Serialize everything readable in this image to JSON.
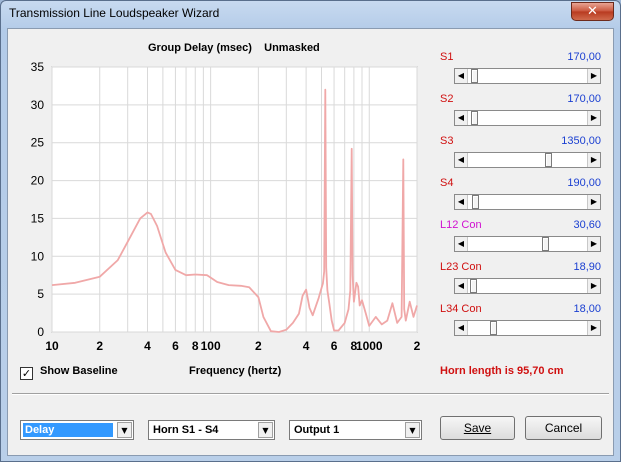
{
  "window": {
    "title": "Transmission Line Loudspeaker Wizard",
    "close_glyph": "✕"
  },
  "chart_header": "Group Delay (msec)    Unmasked",
  "chart_data": {
    "type": "line",
    "title": "Group Delay (msec)",
    "subtitle": "Unmasked",
    "xlabel": "Frequency (hertz)",
    "ylabel": "",
    "x_scale": "log",
    "xlim": [
      10,
      2000
    ],
    "ylim": [
      0,
      35
    ],
    "y_ticks": [
      0,
      5,
      10,
      15,
      20,
      25,
      30,
      35
    ],
    "x_ticks": [
      {
        "value": 10,
        "label": "10"
      },
      {
        "value": 20,
        "label": "2"
      },
      {
        "value": 40,
        "label": "4"
      },
      {
        "value": 60,
        "label": "6"
      },
      {
        "value": 80,
        "label": "8"
      },
      {
        "value": 100,
        "label": "100"
      },
      {
        "value": 200,
        "label": "2"
      },
      {
        "value": 400,
        "label": "4"
      },
      {
        "value": 600,
        "label": "6"
      },
      {
        "value": 800,
        "label": "8"
      },
      {
        "value": 1000,
        "label": "1000"
      },
      {
        "value": 2000,
        "label": "2"
      }
    ],
    "grid": true,
    "line_color": "#f0a8a8",
    "series": [
      {
        "x": [
          10,
          14,
          20,
          26,
          32,
          36,
          40,
          42,
          46,
          52,
          60,
          70,
          80,
          95,
          110,
          130,
          155,
          175,
          200,
          215,
          240,
          270,
          300,
          330,
          360,
          380,
          400,
          420,
          440,
          460,
          480,
          500,
          510,
          520,
          528,
          535,
          545,
          560,
          580,
          600,
          640,
          700,
          740,
          760,
          775,
          785,
          800,
          830,
          850,
          870,
          900,
          950,
          1000,
          1100,
          1200,
          1300,
          1400,
          1500,
          1600,
          1640,
          1660,
          1700,
          1800,
          1900,
          2000
        ],
        "y": [
          6.2,
          6.5,
          7.3,
          9.5,
          13.0,
          15.0,
          15.8,
          15.6,
          14.0,
          10.5,
          8.2,
          7.5,
          7.6,
          7.5,
          6.6,
          6.2,
          6.1,
          5.9,
          4.6,
          2.0,
          0.1,
          0.0,
          0.3,
          1.2,
          2.4,
          4.8,
          5.6,
          3.2,
          2.2,
          3.4,
          4.5,
          5.8,
          6.4,
          8.0,
          32.0,
          8.5,
          5.5,
          3.8,
          1.5,
          0.2,
          0.2,
          1.2,
          3.0,
          5.5,
          24.2,
          7.5,
          4.0,
          6.5,
          6.0,
          3.5,
          4.2,
          2.5,
          0.8,
          2.0,
          1.0,
          1.5,
          3.8,
          1.2,
          2.0,
          22.8,
          3.0,
          1.5,
          4.0,
          2.0,
          3.5
        ]
      }
    ]
  },
  "params": [
    {
      "label": "S1",
      "value": "170,00",
      "color": "#d01010",
      "fraction": 0.03
    },
    {
      "label": "S2",
      "value": "170,00",
      "color": "#d01010",
      "fraction": 0.03
    },
    {
      "label": "S3",
      "value": "1350,00",
      "color": "#d01010",
      "fraction": 0.69
    },
    {
      "label": "S4",
      "value": "190,00",
      "color": "#d01010",
      "fraction": 0.04
    },
    {
      "label": "L12  Con",
      "value": "30,60",
      "color": "#d010d0",
      "fraction": 0.66
    },
    {
      "label": "L23  Con",
      "value": "18,90",
      "color": "#d01010",
      "fraction": 0.02
    },
    {
      "label": "L34  Con",
      "value": "18,00",
      "color": "#d01010",
      "fraction": 0.2
    }
  ],
  "show_baseline": {
    "label": "Show Baseline",
    "checked_glyph": "✓"
  },
  "horn_length": "Horn length is 95,70 cm",
  "combos": [
    {
      "value": "Delay",
      "name": "display-mode-combo"
    },
    {
      "value": "Horn S1 - S4",
      "name": "section-combo"
    },
    {
      "value": "Output 1",
      "name": "output-combo"
    }
  ],
  "buttons": {
    "save": "Save",
    "cancel": "Cancel"
  }
}
